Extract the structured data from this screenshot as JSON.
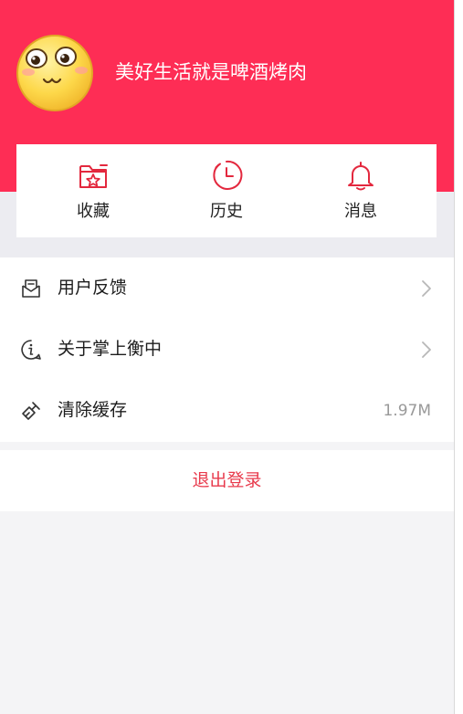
{
  "profile": {
    "username": "美好生活就是啤酒烤肉",
    "avatar_icon": "emoji-face-icon"
  },
  "quick_actions": [
    {
      "label": "收藏",
      "icon": "favorites-folder-icon"
    },
    {
      "label": "历史",
      "icon": "clock-icon"
    },
    {
      "label": "消息",
      "icon": "bell-icon"
    }
  ],
  "menu": {
    "items": [
      {
        "label": "用户反馈",
        "icon": "feedback-envelope-icon",
        "has_chevron": true
      },
      {
        "label": "关于掌上衡中",
        "icon": "info-bubble-icon",
        "has_chevron": true
      },
      {
        "label": "清除缓存",
        "icon": "broom-icon",
        "value": "1.97M"
      }
    ]
  },
  "logout": {
    "label": "退出登录"
  },
  "colors": {
    "brand": "#fe2d55",
    "icon_red": "#e3283e",
    "logout_text": "#e83a4c"
  }
}
